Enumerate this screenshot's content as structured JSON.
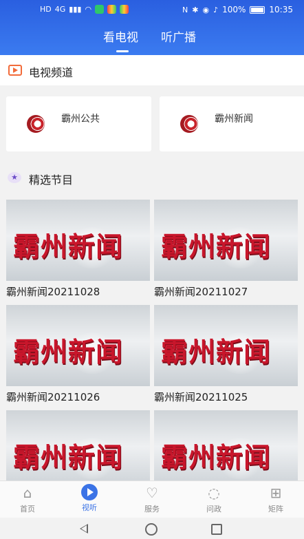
{
  "status_bar": {
    "left_indicators": [
      "HD",
      "4G",
      "signal",
      "wifi"
    ],
    "battery": "100%",
    "time": "10:35"
  },
  "top_tabs": [
    {
      "label": "看电视",
      "active": true
    },
    {
      "label": "听广播",
      "active": false
    }
  ],
  "channels_section": {
    "title": "电视频道",
    "items": [
      {
        "name": "霸州公共"
      },
      {
        "name": "霸州新闻"
      }
    ]
  },
  "featured_section": {
    "title": "精选节目",
    "thumbnail_caption": "霸州新闻",
    "programs": [
      {
        "title": "霸州新闻20211028"
      },
      {
        "title": "霸州新闻20211027"
      },
      {
        "title": "霸州新闻20211026"
      },
      {
        "title": "霸州新闻20211025"
      },
      {
        "title": ""
      },
      {
        "title": ""
      }
    ]
  },
  "bottom_nav": [
    {
      "label": "首页",
      "icon": "home-icon",
      "active": false
    },
    {
      "label": "视听",
      "icon": "play-icon",
      "active": true
    },
    {
      "label": "服务",
      "icon": "heart-icon",
      "active": false
    },
    {
      "label": "问政",
      "icon": "chat-icon",
      "active": false
    },
    {
      "label": "矩阵",
      "icon": "grid-icon",
      "active": false
    }
  ],
  "colors": {
    "header_blue": "#2a5fe0",
    "accent_blue": "#3b73e6",
    "tv_icon_orange": "#f26b3a",
    "logo_red": "#c8162b"
  }
}
